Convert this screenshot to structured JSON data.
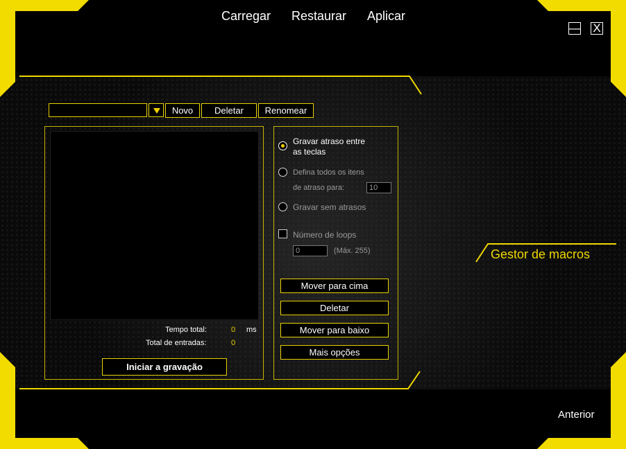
{
  "menu": {
    "load": "Carregar",
    "restore": "Restaurar",
    "apply": "Aplicar"
  },
  "window": {
    "minimize_glyph": "—",
    "close_glyph": "X"
  },
  "macro_select": {
    "value": ""
  },
  "toolbar": {
    "new": "Novo",
    "delete": "Deletar",
    "rename": "Renomear"
  },
  "recording": {
    "total_time_label": "Tempo total:",
    "total_time_value": "0",
    "total_time_unit": "ms",
    "total_entries_label": "Total de entradas:",
    "total_entries_value": "0",
    "start_button": "Iniciar a gravação"
  },
  "options": {
    "record_delay_line1": "Gravar atraso entre",
    "record_delay_line2": "as teclas",
    "set_delay_line1": "Defina todos os itens",
    "set_delay_line2": "de atraso para:",
    "set_delay_value": "10",
    "no_delay": "Gravar sem atrasos",
    "loops_label": "Número de loops",
    "loops_value": "0",
    "loops_max": "(Máx. 255)",
    "selected": "record_delay"
  },
  "actions": {
    "move_up": "Mover para cima",
    "delete": "Deletar",
    "move_down": "Mover para baixo",
    "more": "Mais opções"
  },
  "section_title": "Gestor de macros",
  "back": "Anterior",
  "colors": {
    "accent": "#f0d800",
    "background": "#0a0a0a"
  }
}
